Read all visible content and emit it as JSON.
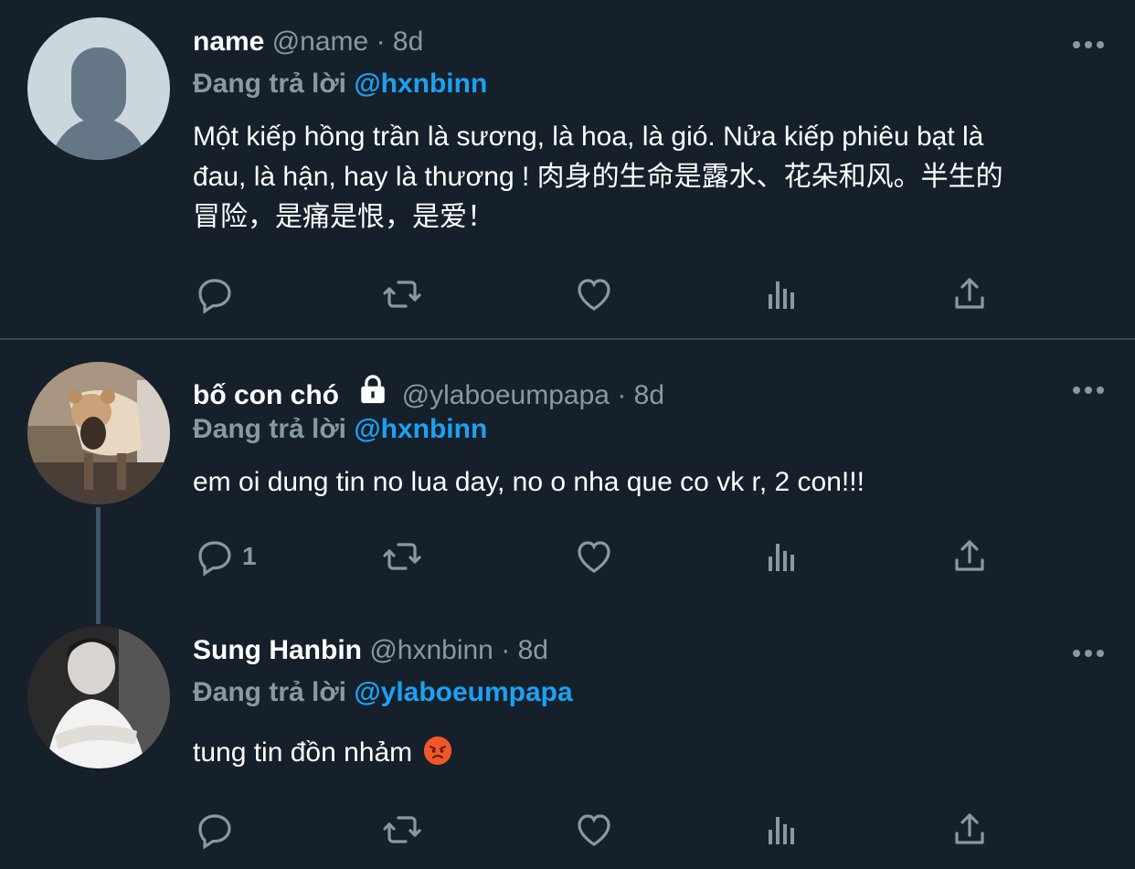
{
  "tweets": [
    {
      "display_name": "name",
      "handle": "@name",
      "separator": "·",
      "time": "8d",
      "reply_prefix": "Đang trả lời",
      "reply_to": "@hxnbinn",
      "text_lines": [
        "Một kiếp hồng trần là sương, là hoa, là gió. Nửa kiếp phiêu bạt là",
        "đau, là hận, hay là thương ! 肉身的生命是露水、花朵和风。半生的",
        "冒险，是痛是恨，是爱！"
      ],
      "avatar": "default-profile-avatar",
      "reply_count": ""
    },
    {
      "display_name": "bố con chó",
      "protected_icon": "lock-icon",
      "handle": "@ylaboeumpapa",
      "separator": "·",
      "time": "8d",
      "reply_prefix": "Đang trả lời",
      "reply_to": "@hxnbinn",
      "text_lines": [
        "em oi dung tin no lua day, no o nha que co vk r, 2 con!!!"
      ],
      "avatar": "dog-photo-avatar",
      "reply_count": "1"
    },
    {
      "display_name": "Sung Hanbin",
      "handle": "@hxnbinn",
      "separator": "·",
      "time": "8d",
      "reply_prefix": "Đang trả lời",
      "reply_to": "@ylaboeumpapa",
      "text_lines": [
        "tung tin đồn nhảm"
      ],
      "emoji": "angry-face-emoji",
      "avatar": "person-photo-avatar",
      "reply_count": ""
    }
  ],
  "action_icons": [
    "reply-icon",
    "retweet-icon",
    "like-icon",
    "analytics-icon",
    "share-icon"
  ],
  "colors": {
    "background": "#15202b",
    "divider": "#38444d",
    "muted_text": "#8899a6",
    "link": "#1da1f2",
    "text": "#ffffff"
  }
}
